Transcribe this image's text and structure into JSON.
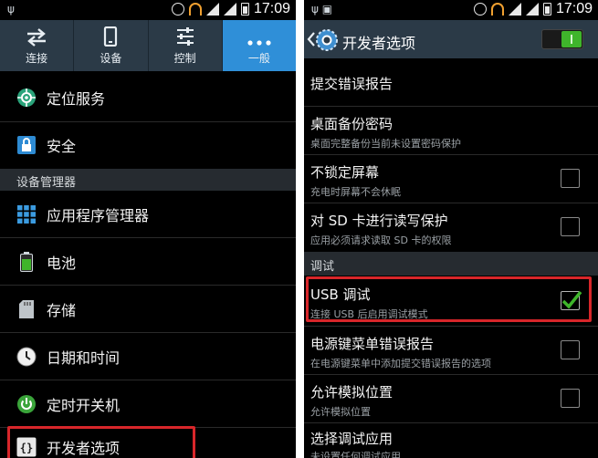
{
  "status_bar": {
    "time": "17:09"
  },
  "left": {
    "tabs": [
      {
        "label": "连接",
        "icon": "swap-arrows-icon"
      },
      {
        "label": "设备",
        "icon": "phone-icon"
      },
      {
        "label": "控制",
        "icon": "sliders-icon"
      },
      {
        "label": "一般",
        "icon": "more-dots-icon",
        "active": true
      }
    ],
    "items": [
      {
        "label": "定位服务",
        "icon": "location-icon"
      },
      {
        "label": "安全",
        "icon": "lock-icon"
      }
    ],
    "section": "设备管理器",
    "manager_items": [
      {
        "label": "应用程序管理器",
        "icon": "apps-grid-icon"
      },
      {
        "label": "电池",
        "icon": "battery-icon"
      },
      {
        "label": "存储",
        "icon": "sd-card-icon"
      },
      {
        "label": "日期和时间",
        "icon": "clock-icon"
      },
      {
        "label": "定时开关机",
        "icon": "power-icon"
      },
      {
        "label": "开发者选项",
        "icon": "braces-icon"
      }
    ]
  },
  "right": {
    "title": "开发者选项",
    "master_switch_on": true,
    "items": [
      {
        "title": "提交错误报告"
      },
      {
        "title": "桌面备份密码",
        "subtitle": "桌面完整备份当前未设置密码保护"
      },
      {
        "title": "不锁定屏幕",
        "subtitle": "充电时屏幕不会休眠",
        "checked": false
      },
      {
        "title": "对 SD 卡进行读写保护",
        "subtitle": "应用必须请求读取 SD 卡的权限",
        "checked": false
      }
    ],
    "section": "调试",
    "debug_items": [
      {
        "title": "USB 调试",
        "subtitle": "连接 USB 后启用调试模式",
        "checked": true
      },
      {
        "title": "电源键菜单错误报告",
        "subtitle": "在电源键菜单中添加提交错误报告的选项",
        "checked": false
      },
      {
        "title": "允许模拟位置",
        "subtitle": "允许模拟位置",
        "checked": false
      },
      {
        "title": "选择调试应用",
        "subtitle": "未设置任何调试应用"
      }
    ]
  },
  "colors": {
    "accent": "#2f8fd8",
    "highlight": "#d8262a",
    "check": "#3fb52b"
  }
}
